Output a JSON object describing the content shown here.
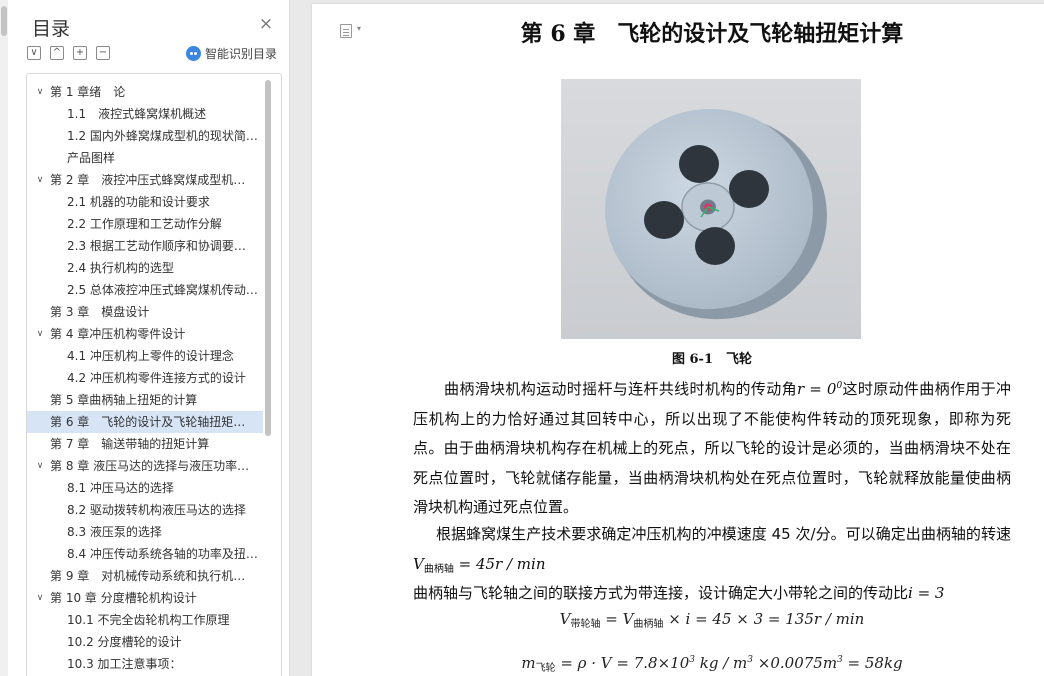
{
  "sidebar": {
    "title": "目录",
    "close_glyph": "×",
    "tools": [
      "∨",
      "^",
      "+",
      "−"
    ],
    "smart_outline_label": "智能识别目录",
    "items": [
      {
        "level": 1,
        "label": "第 1 章绪　论",
        "caret": "∨",
        "active": false
      },
      {
        "level": 2,
        "label": "1.1　液控式蜂窝煤机概述",
        "caret": "",
        "active": false
      },
      {
        "level": 2,
        "label": "1.2 国内外蜂窝煤成型机的现状简…",
        "caret": "",
        "active": false
      },
      {
        "level": 2,
        "label": "产品图样",
        "caret": "",
        "active": false
      },
      {
        "level": 1,
        "label": "第 2 章　液控冲压式蜂窝煤成型机…",
        "caret": "∨",
        "active": false
      },
      {
        "level": 2,
        "label": "2.1  机器的功能和设计要求",
        "caret": "",
        "active": false
      },
      {
        "level": 2,
        "label": "2.2  工作原理和工艺动作分解",
        "caret": "",
        "active": false
      },
      {
        "level": 2,
        "label": "2.3  根据工艺动作顺序和协调要…",
        "caret": "",
        "active": false
      },
      {
        "level": 2,
        "label": "2.4 执行机构的选型",
        "caret": "",
        "active": false
      },
      {
        "level": 2,
        "label": "2.5 总体液控冲压式蜂窝煤机传动…",
        "caret": "",
        "active": false
      },
      {
        "level": 1,
        "label": "第 3 章　模盘设计",
        "caret": "",
        "active": false
      },
      {
        "level": 1,
        "label": "第 4 章冲压机构零件设计",
        "caret": "∨",
        "active": false
      },
      {
        "level": 2,
        "label": "4.1 冲压机构上零件的设计理念",
        "caret": "",
        "active": false
      },
      {
        "level": 2,
        "label": "4.2 冲压机构零件连接方式的设计",
        "caret": "",
        "active": false
      },
      {
        "level": 1,
        "label": "第 5 章曲柄轴上扭矩的计算",
        "caret": "",
        "active": false
      },
      {
        "level": 1,
        "label": "第 6 章　飞轮的设计及飞轮轴扭矩…",
        "caret": "",
        "active": true
      },
      {
        "level": 1,
        "label": "第 7 章　输送带轴的扭矩计算",
        "caret": "",
        "active": false
      },
      {
        "level": 1,
        "label": "第 8 章 液压马达的选择与液压功率…",
        "caret": "∨",
        "active": false
      },
      {
        "level": 2,
        "label": "8.1 冲压马达的选择",
        "caret": "",
        "active": false
      },
      {
        "level": 2,
        "label": "8.2 驱动拨转机构液压马达的选择",
        "caret": "",
        "active": false
      },
      {
        "level": 2,
        "label": "8.3 液压泵的选择",
        "caret": "",
        "active": false
      },
      {
        "level": 2,
        "label": "8.4 冲压传动系统各轴的功率及扭…",
        "caret": "",
        "active": false
      },
      {
        "level": 1,
        "label": "第 9 章　对机械传动系统和执行机…",
        "caret": "",
        "active": false
      },
      {
        "level": 1,
        "label": "第 10 章  分度槽轮机构设计",
        "caret": "∨",
        "active": false
      },
      {
        "level": 2,
        "label": "10.1 不完全齿轮机构工作原理",
        "caret": "",
        "active": false
      },
      {
        "level": 2,
        "label": "10.2 分度槽轮的设计",
        "caret": "",
        "active": false
      },
      {
        "level": 2,
        "label": "10.3 加工注意事项：",
        "caret": "",
        "active": false
      }
    ]
  },
  "document": {
    "chapter_title": "第 6 章　飞轮的设计及飞轮轴扭矩计算",
    "figure_caption": "图 6-1　飞轮",
    "p1_text_a": "曲柄滑块机构运动时摇杆与连杆共线时机构的传动角",
    "p1_math": "r = 0",
    "p1_math_sup": "0",
    "p1_text_b": "这时原动件曲柄作用于冲压机构上的力恰好通过其回转中心，所以出现了不能使构件转动的顶死现象，即称为死点。由于曲柄滑块机构存在机械上的死点，所以飞轮的设计是必须的，当曲柄滑块不处在死点位置时，飞轮就储存能量，当曲柄滑块机构处在死点位置时，飞轮就释放能量使曲柄滑块机构通过死点位置。",
    "p2_text": "根据蜂窝煤生产技术要求确定冲压机构的冲模速度 45 次/分。可以确定出曲柄轴的转速",
    "p2_math_v": "V",
    "p2_math_sub": "曲柄轴",
    "p2_math_rest": " = 45r / min",
    "p3_text": "曲柄轴与飞轮轴之间的联接方式为带连接，设计确定大小带轮之间的传动比",
    "p3_math": "i = 3",
    "eq1_v1": "V",
    "eq1_sub1": "带轮轴",
    "eq1_mid": " = V",
    "eq1_sub2": "曲柄轴",
    "eq1_rest": " × i = 45 × 3 = 135r / min",
    "eq2_m": "m",
    "eq2_sub": "飞轮",
    "eq2_a": " = ρ · V = 7.8×10",
    "eq2_sup1": "3",
    "eq2_b": " kg / m",
    "eq2_sup2": "3",
    "eq2_c": " ×0.0075m",
    "eq2_sup3": "3",
    "eq2_d": " = 58kg"
  },
  "colors": {
    "active_item_bg": "#d6e4f6",
    "smart_outline_icon": "#3a86e0",
    "flywheel_face": "#b8c5d2"
  },
  "icons": {
    "page_view": "document-icon",
    "close": "close-icon",
    "smart_outline": "ai-icon"
  }
}
